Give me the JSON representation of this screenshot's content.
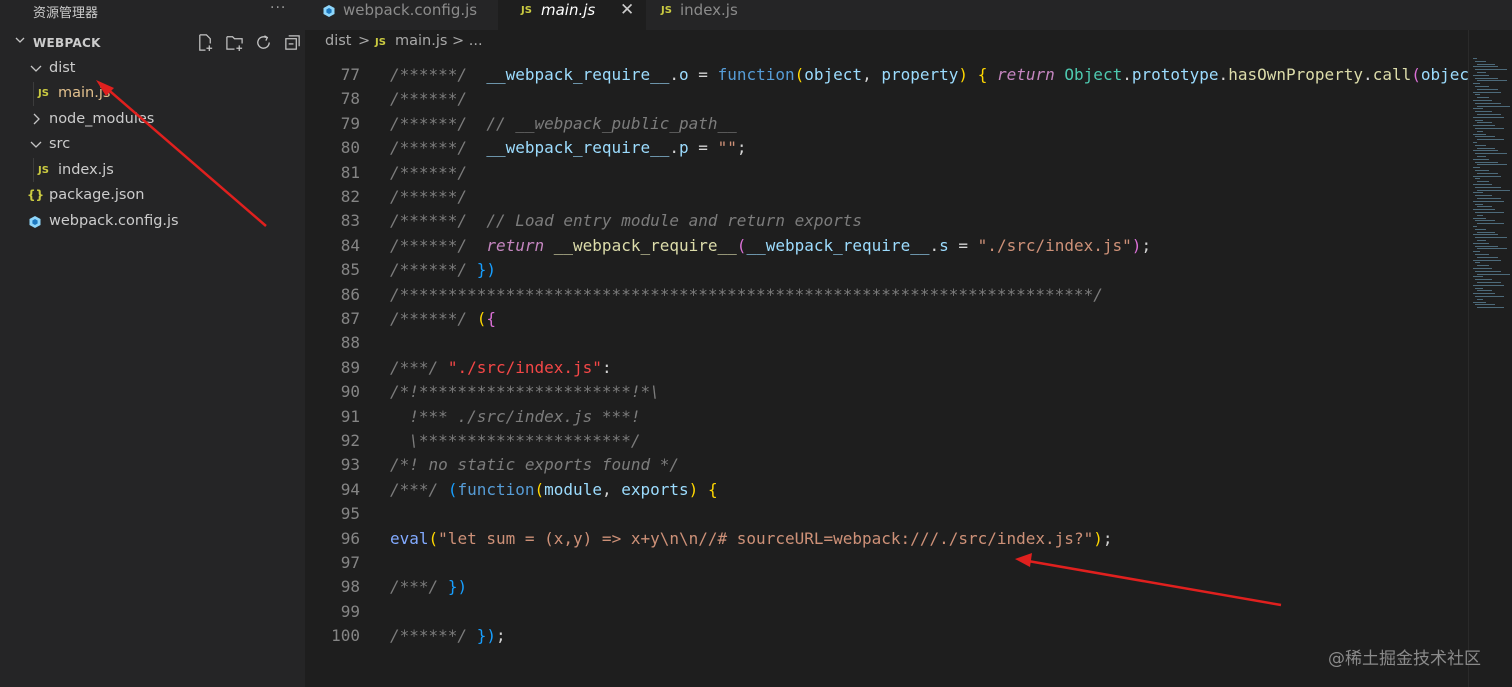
{
  "sidebar": {
    "title": "资源管理器",
    "more": "···",
    "section_label": "WEBPACK",
    "tree": [
      {
        "name": "dist",
        "kind": "folder",
        "expanded": true
      },
      {
        "name": "main.js",
        "kind": "js",
        "active": true
      },
      {
        "name": "node_modules",
        "kind": "folder",
        "expanded": false
      },
      {
        "name": "src",
        "kind": "folder",
        "expanded": true
      },
      {
        "name": "index.js",
        "kind": "js"
      },
      {
        "name": "package.json",
        "kind": "json"
      },
      {
        "name": "webpack.config.js",
        "kind": "webpack"
      }
    ]
  },
  "tabs": [
    {
      "label": "webpack.config.js",
      "icon": "webpack-icon"
    },
    {
      "label": "main.js",
      "icon": "JS",
      "active": true
    },
    {
      "label": "index.js",
      "icon": "JS"
    }
  ],
  "breadcrumb": {
    "part1": "dist",
    "sep": ">",
    "icon": "JS",
    "part2": "main.js",
    "tail": "> ..."
  },
  "editor": {
    "lines": [
      {
        "n": "77",
        "html": "<span class='c-gray'>/******/</span>  <span class='c-var'>__webpack_require__</span><span class='c-op'>.</span><span class='c-var'>o</span> <span class='c-op'>=</span> <span class='c-kw2'>function</span><span class='c-br'>(</span><span class='c-var'>object</span><span class='c-op'>,</span> <span class='c-var'>property</span><span class='c-br'>)</span> <span class='c-br'>{</span> <span class='c-kw'>return</span> <span class='c-cls'>Object</span><span class='c-op'>.</span><span class='c-var'>prototype</span><span class='c-op'>.</span><span class='c-fn'>hasOwnProperty</span><span class='c-op'>.</span><span class='c-fn'>call</span><span class='c-br2'>(</span><span class='c-var'>object</span>"
      },
      {
        "n": "78",
        "html": "<span class='c-gray'>/******/</span>"
      },
      {
        "n": "79",
        "html": "<span class='c-gray'>/******/</span>  <span class='c-gray'>// __webpack_public_path__</span>"
      },
      {
        "n": "80",
        "html": "<span class='c-gray'>/******/</span>  <span class='c-var'>__webpack_require__</span><span class='c-op'>.</span><span class='c-var'>p</span> <span class='c-op'>=</span> <span class='c-str'>\"\"</span><span class='c-op'>;</span>"
      },
      {
        "n": "81",
        "html": "<span class='c-gray'>/******/</span>"
      },
      {
        "n": "82",
        "html": "<span class='c-gray'>/******/</span>"
      },
      {
        "n": "83",
        "html": "<span class='c-gray'>/******/</span>  <span class='c-gray'>// Load entry module and return exports</span>"
      },
      {
        "n": "84",
        "html": "<span class='c-gray'>/******/</span>  <span class='c-kw'>return</span> <span class='c-fn'>__webpack_require__</span><span class='c-br2'>(</span><span class='c-var'>__webpack_require__</span><span class='c-op'>.</span><span class='c-var'>s</span> <span class='c-op'>=</span> <span class='c-str'>\"./src/index.js\"</span><span class='c-br2'>)</span><span class='c-op'>;</span>"
      },
      {
        "n": "85",
        "html": "<span class='c-gray'>/******/</span> <span class='c-br3'>})</span>"
      },
      {
        "n": "86",
        "html": "<span class='c-gray'>/************************************************************************/</span>"
      },
      {
        "n": "87",
        "html": "<span class='c-gray'>/******/</span> <span class='c-br'>(</span><span class='c-br2'>{</span>"
      },
      {
        "n": "88",
        "html": ""
      },
      {
        "n": "89",
        "html": "<span class='c-gray'>/***/</span> <span class='c-str2'>\"./src/index.js\"</span><span class='c-op'>:</span>"
      },
      {
        "n": "90",
        "html": "<span class='c-gray'>/*!**********************!*\\</span>"
      },
      {
        "n": "91",
        "html": "<span class='c-gray'>  !*** ./src/index.js ***!</span>"
      },
      {
        "n": "92",
        "html": "<span class='c-gray'>  \\**********************/</span>"
      },
      {
        "n": "93",
        "html": "<span class='c-gray'>/*! no static exports found */</span>"
      },
      {
        "n": "94",
        "html": "<span class='c-gray'>/***/</span> <span class='c-br3'>(</span><span class='c-kw2'>function</span><span class='c-br'>(</span><span class='c-var'>module</span><span class='c-op'>,</span> <span class='c-var'>exports</span><span class='c-br'>)</span> <span class='c-br'>{</span>"
      },
      {
        "n": "95",
        "html": ""
      },
      {
        "n": "96",
        "html": "<span class='c-eval'>eval</span><span class='c-br'>(</span><span class='c-str'>\"let sum = (x,y) =&gt; x+y\\n\\n//# sourceURL=webpack:///./src/index.js?\"</span><span class='c-br'>)</span><span class='c-op'>;</span>"
      },
      {
        "n": "97",
        "html": ""
      },
      {
        "n": "98",
        "html": "<span class='c-gray'>/***/</span> <span class='c-br3'>})</span>"
      },
      {
        "n": "99",
        "html": ""
      },
      {
        "n": "100",
        "html": "<span class='c-gray'>/******/</span> <span class='c-br3'>})</span><span class='c-op'>;</span>"
      }
    ]
  },
  "watermark": "@稀土掘金技术社区",
  "colors": {
    "arrow": "#e0201e",
    "sidebar_bg": "#252526",
    "editor_bg": "#1e1e1e"
  }
}
